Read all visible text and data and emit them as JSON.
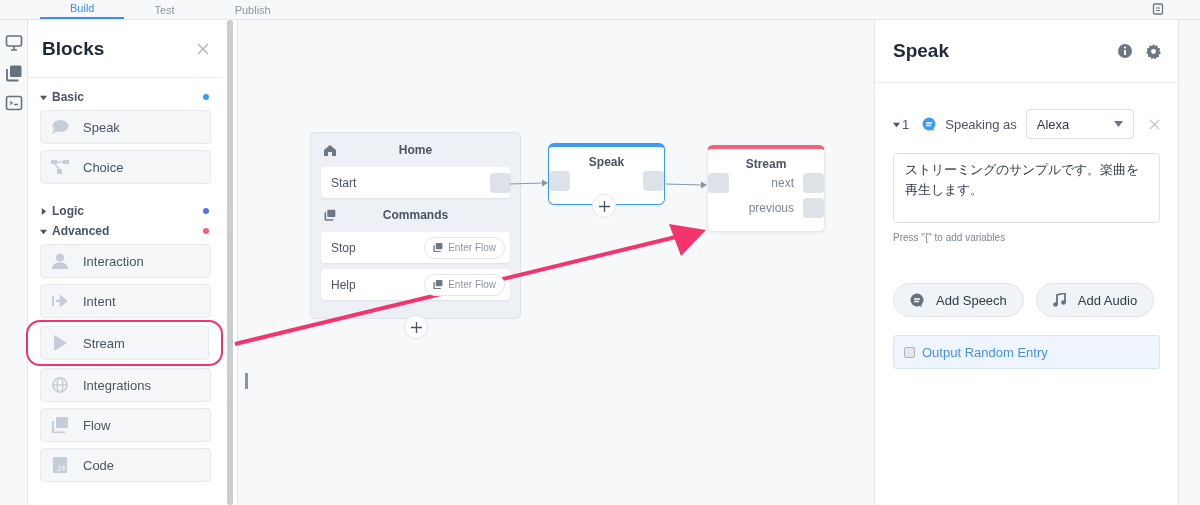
{
  "tabs": [
    {
      "label": "Build",
      "selected": true
    },
    {
      "label": "Test",
      "selected": false
    },
    {
      "label": "Publish",
      "selected": false
    }
  ],
  "blocks_panel": {
    "title": "Blocks",
    "sections": [
      {
        "title": "Basic",
        "expanded": true,
        "color": "#3d9bf5",
        "items": [
          {
            "label": "Speak",
            "kind": "speech",
            "highlighted": false
          },
          {
            "label": "Choice",
            "kind": "choice",
            "highlighted": false
          }
        ]
      },
      {
        "title": "Logic",
        "expanded": false,
        "color": "#5b6ef0"
      },
      {
        "title": "Advanced",
        "expanded": true,
        "color": "#f2607a",
        "items": [
          {
            "label": "Interaction",
            "kind": "person",
            "highlighted": false
          },
          {
            "label": "Intent",
            "kind": "intent",
            "highlighted": false
          },
          {
            "label": "Stream",
            "kind": "play",
            "highlighted": true
          },
          {
            "label": "Integrations",
            "kind": "globe",
            "highlighted": false
          },
          {
            "label": "Flow",
            "kind": "flow",
            "highlighted": false
          },
          {
            "label": "Code",
            "kind": "code",
            "highlighted": false
          }
        ]
      }
    ]
  },
  "canvas": {
    "home": {
      "title": "Home",
      "start": "Start",
      "commands_title": "Commands",
      "commands": [
        {
          "label": "Stop",
          "button": "Enter Flow"
        },
        {
          "label": "Help",
          "button": "Enter Flow"
        }
      ]
    },
    "nodes": [
      {
        "title": "Speak",
        "color": "#3d9bf5",
        "selected": true
      },
      {
        "title": "Stream",
        "color": "#f2607a",
        "selected": false,
        "ports": [
          "next",
          "previous"
        ]
      }
    ]
  },
  "inspector": {
    "title": "Speak",
    "entry": {
      "index": "1",
      "expanded": true,
      "label": "Speaking as",
      "voice": "Alexa",
      "text": "ストリーミングのサンプルです。楽曲を再生します。",
      "hint": "Press \"{\" to add variables"
    },
    "buttons": [
      {
        "label": "Add Speech",
        "kind": "speech"
      },
      {
        "label": "Add Audio",
        "kind": "audio"
      }
    ],
    "random_entry": {
      "label": "Output Random Entry",
      "checked": false
    }
  }
}
